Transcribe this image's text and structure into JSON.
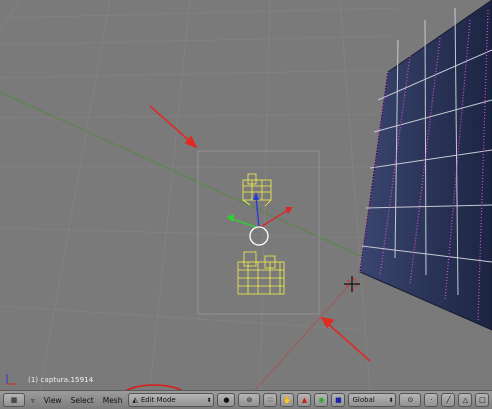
{
  "viewport": {
    "object_label": "(1) captura.15914"
  },
  "header": {
    "menus": [
      "View",
      "Select",
      "Mesh"
    ],
    "mode_selector": {
      "icon": "edit-mode-triangle-icon",
      "value": "Edit Mode"
    },
    "orientation_selector": {
      "value": "Global"
    }
  },
  "annotations": {
    "arrow_color": "#e02a22",
    "circle_color": "#d81c18"
  },
  "colors": {
    "viewport_bg": "#7a7a7a",
    "grid_line": "#858585",
    "selected_mesh": "#f3f34a",
    "wall_edge": "#1d2340",
    "wall_vertex": "#d84bd6"
  },
  "icons": [
    "editor-type-grid-icon",
    "view-menu-arrow-icon",
    "sphere-shading-icon",
    "pivot-point-icon",
    "snap-icon",
    "hand-manipulator-icon",
    "translate-arrow-icon",
    "rotate-icon",
    "scale-icon",
    "proportional-edit-icon",
    "vertex-select-icon",
    "edge-select-icon",
    "face-select-icon",
    "occlude-geometry-icon"
  ]
}
